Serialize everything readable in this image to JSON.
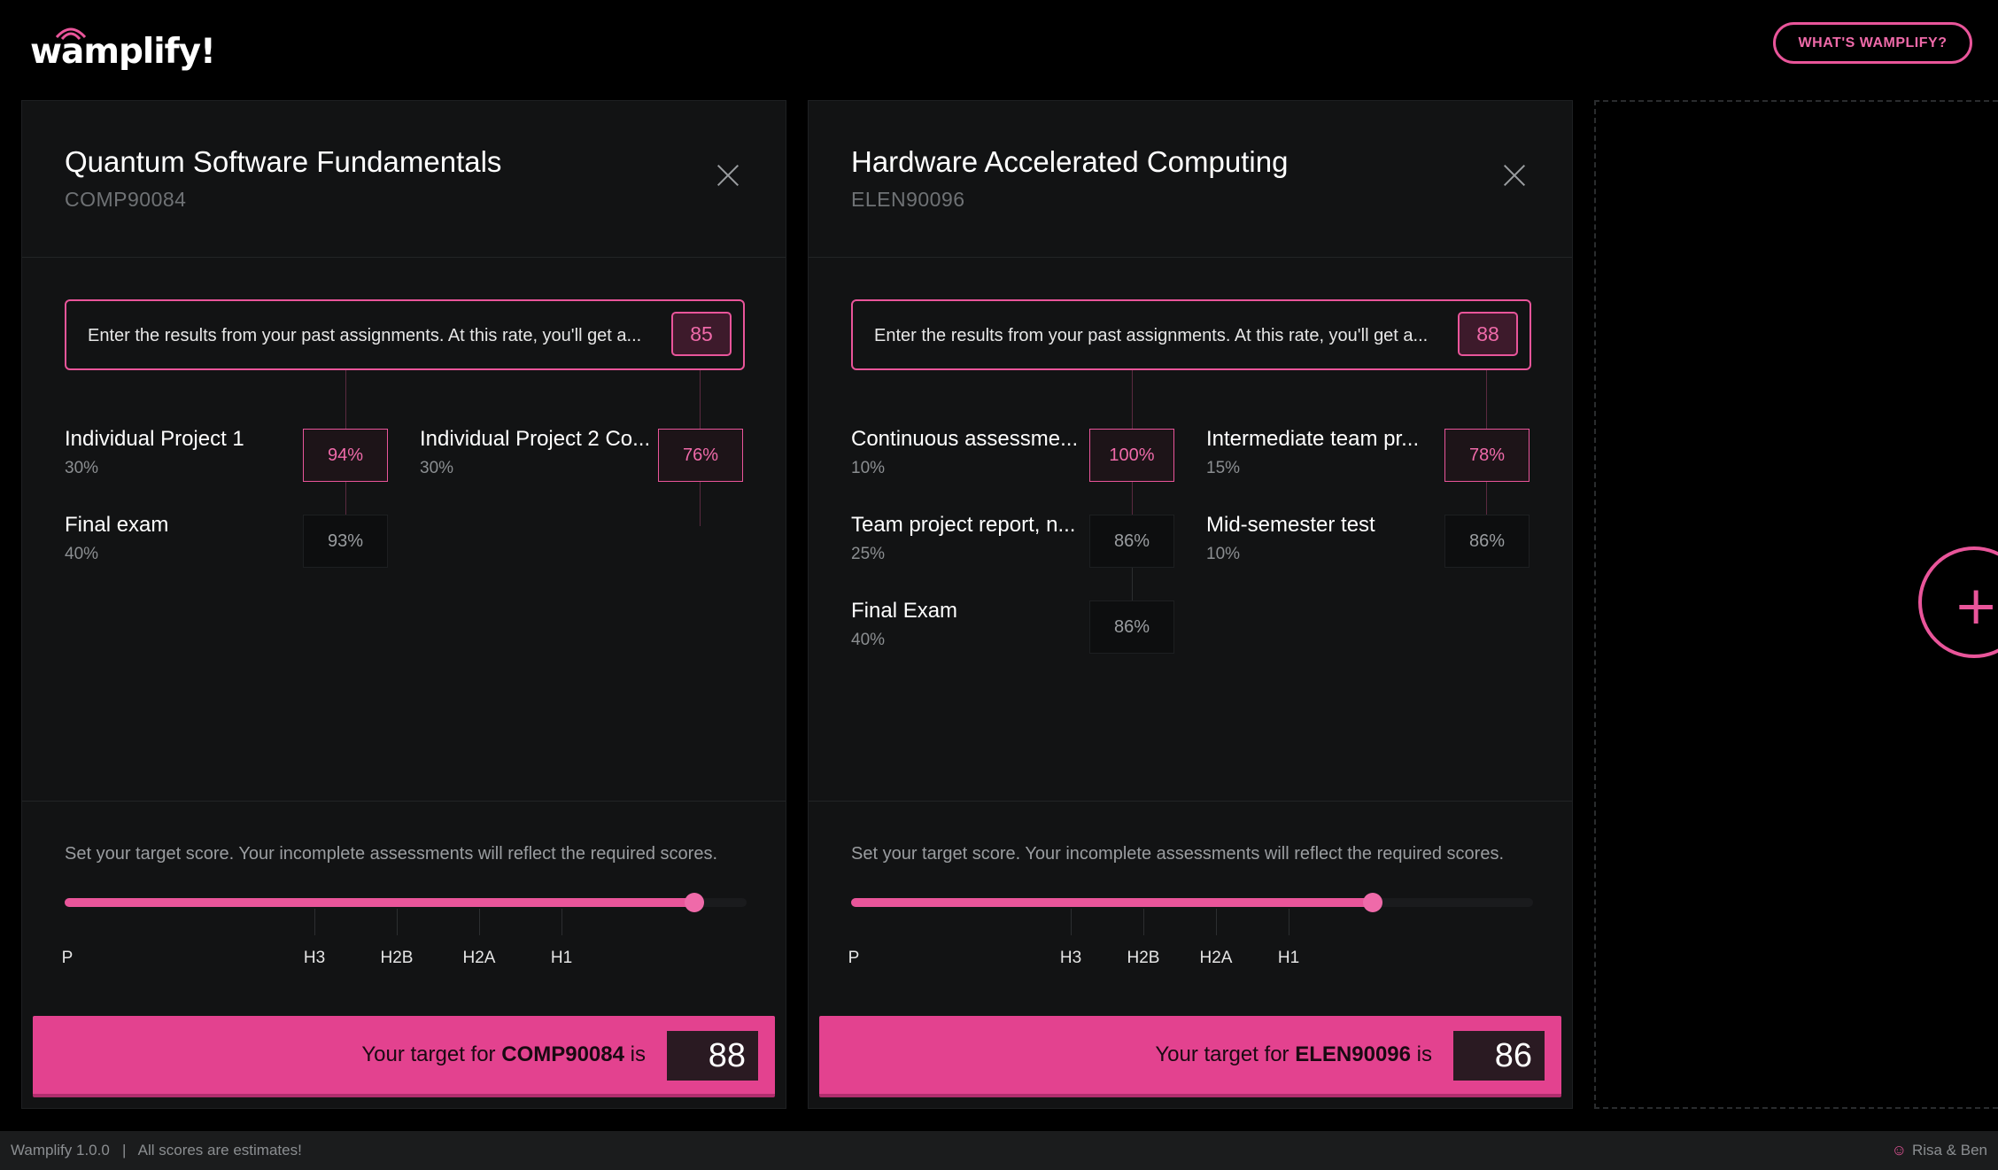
{
  "header": {
    "logo_text": "wamplify!",
    "whats_button": "WHAT'S WAMPLIFY?"
  },
  "cards": [
    {
      "title": "Quantum Software Fundamentals",
      "code": "COMP90084",
      "past_prompt": "Enter the results from your past assignments. At this rate, you'll get a...",
      "past_score": "85",
      "assessments": [
        {
          "name": "Individual Project 1",
          "weight": "30%",
          "score": "94%",
          "state": "entered"
        },
        {
          "name": "Individual Project 2 Co...",
          "weight": "30%",
          "score": "76%",
          "state": "entered"
        },
        {
          "name": "Final exam",
          "weight": "40%",
          "score": "93%",
          "state": "required"
        }
      ],
      "target_prompt": "Set your target score. Your incomplete assessments will reflect the required scores.",
      "slider_labels": [
        "P",
        "H3",
        "H2B",
        "H2A",
        "H1"
      ],
      "target_prefix": "Your target for",
      "target_code": "COMP90084",
      "target_suffix": "is",
      "target_value": "88"
    },
    {
      "title": "Hardware Accelerated Computing",
      "code": "ELEN90096",
      "past_prompt": "Enter the results from your past assignments. At this rate, you'll get a...",
      "past_score": "88",
      "assessments": [
        {
          "name": "Continuous assessme...",
          "weight": "10%",
          "score": "100%",
          "state": "entered"
        },
        {
          "name": "Intermediate team pr...",
          "weight": "15%",
          "score": "78%",
          "state": "entered"
        },
        {
          "name": "Team project report, n...",
          "weight": "25%",
          "score": "86%",
          "state": "required"
        },
        {
          "name": "Mid-semester test",
          "weight": "10%",
          "score": "86%",
          "state": "required"
        },
        {
          "name": "Final Exam",
          "weight": "40%",
          "score": "86%",
          "state": "required"
        }
      ],
      "target_prompt": "Set your target score. Your incomplete assessments will reflect the required scores.",
      "slider_labels": [
        "P",
        "H3",
        "H2B",
        "H2A",
        "H1"
      ],
      "target_prefix": "Your target for",
      "target_code": "ELEN90096",
      "target_suffix": "is",
      "target_value": "86"
    }
  ],
  "footer": {
    "version": "Wamplify 1.0.0",
    "separator": "|",
    "note": "All scores are estimates!",
    "authors": "Risa & Ben"
  },
  "colors": {
    "accent": "#e9559a",
    "target_bar": "#e3428f",
    "card_bg": "#121314"
  }
}
